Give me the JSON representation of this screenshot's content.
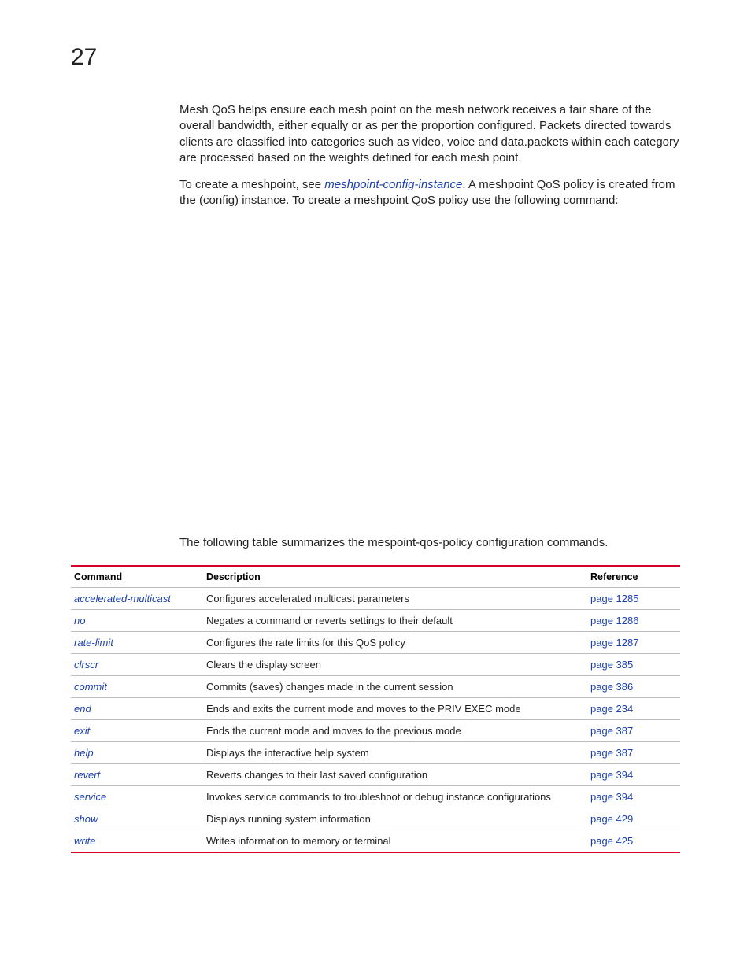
{
  "pageNumber": "27",
  "paragraphs": {
    "p1": "Mesh QoS helps ensure each mesh point on the mesh network receives a fair share of the overall bandwidth, either equally or as per the proportion configured. Packets directed towards clients are classified into categories such as video, voice and data.packets within each category are processed based on the weights defined for each mesh point.",
    "p2a": "To create a meshpoint, see ",
    "p2link": "meshpoint-config-instance",
    "p2b": ". A meshpoint QoS policy is created from the (config) instance. To create a meshpoint QoS policy use the following command:"
  },
  "tableLead": "The following table summarizes the mespoint-qos-policy configuration commands.",
  "tableHeaders": {
    "command": "Command",
    "description": "Description",
    "reference": "Reference"
  },
  "rows": [
    {
      "command": "accelerated-multicast",
      "description": "Configures accelerated multicast parameters",
      "reference": "page 1285"
    },
    {
      "command": "no",
      "description": "Negates a command or reverts settings to their default",
      "reference": "page 1286"
    },
    {
      "command": "rate-limit",
      "description": "Configures the rate limits for this QoS policy",
      "reference": "page 1287"
    },
    {
      "command": "clrscr",
      "description": "Clears the display screen",
      "reference": "page 385"
    },
    {
      "command": "commit",
      "description": "Commits (saves) changes made in the current session",
      "reference": "page 386"
    },
    {
      "command": "end",
      "description": "Ends and exits the current mode and moves to the PRIV EXEC mode",
      "reference": "page 234"
    },
    {
      "command": "exit",
      "description": "Ends the current mode and moves to the previous mode",
      "reference": "page 387"
    },
    {
      "command": "help",
      "description": "Displays the interactive help system",
      "reference": "page 387"
    },
    {
      "command": "revert",
      "description": "Reverts changes to their last saved configuration",
      "reference": "page 394"
    },
    {
      "command": "service",
      "description": "Invokes service commands to troubleshoot or debug                                     instance configurations",
      "reference": "page 394"
    },
    {
      "command": "show",
      "description": "Displays running system information",
      "reference": "page 429"
    },
    {
      "command": "write",
      "description": "Writes information to memory or terminal",
      "reference": "page 425"
    }
  ]
}
